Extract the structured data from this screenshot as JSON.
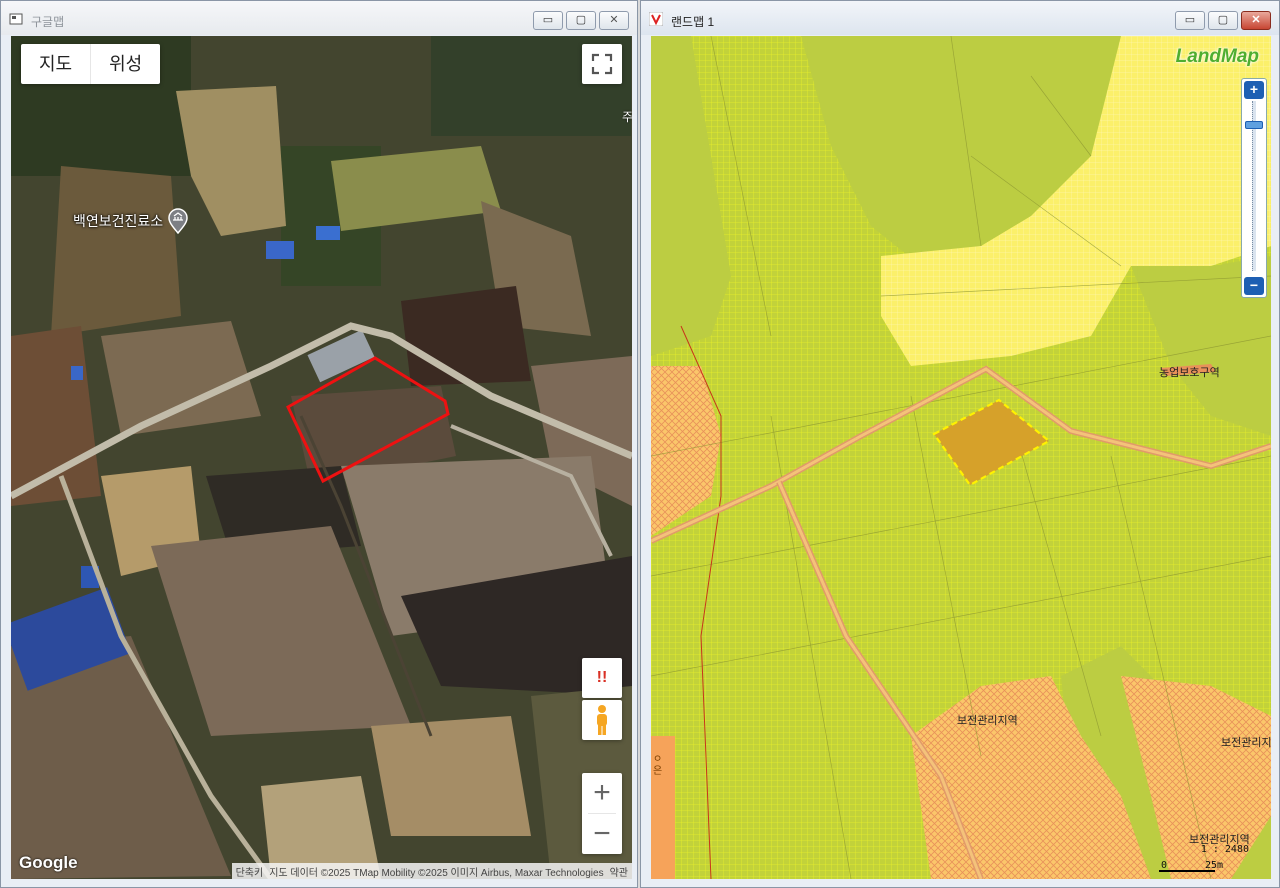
{
  "left_window": {
    "title": "구글맵",
    "controls": {
      "minimize": "▭",
      "maximize": "▢",
      "close": "✕"
    },
    "map_type": {
      "map": "지도",
      "satellite": "위성"
    },
    "poi_label": "백연보건진료소",
    "edge_text": "주",
    "alert_label": "!!",
    "zoom_in": "+",
    "zoom_out": "−",
    "logo": "Google",
    "attribution": {
      "shortcut": "단축키",
      "data": "지도 데이터 ©2025 TMap Mobility ©2025 이미지 Airbus, Maxar Technologies",
      "terms": "약관"
    }
  },
  "right_window": {
    "title": "랜드맵 1",
    "controls": {
      "minimize": "▭",
      "maximize": "▢",
      "close": "✕"
    },
    "logo": "LandMap",
    "zoom_in": "+",
    "zoom_out": "−",
    "labels": {
      "agri_protect": "농업보호구역",
      "conserve_1": "보전관리지역",
      "conserve_2": "보전관리지",
      "conserve_3": "보전관리지역"
    },
    "left_edge_text": "ㅇ은",
    "scale_ratio": "1 : 2480",
    "scale_zero": "0",
    "scale_dist": "25m"
  }
}
